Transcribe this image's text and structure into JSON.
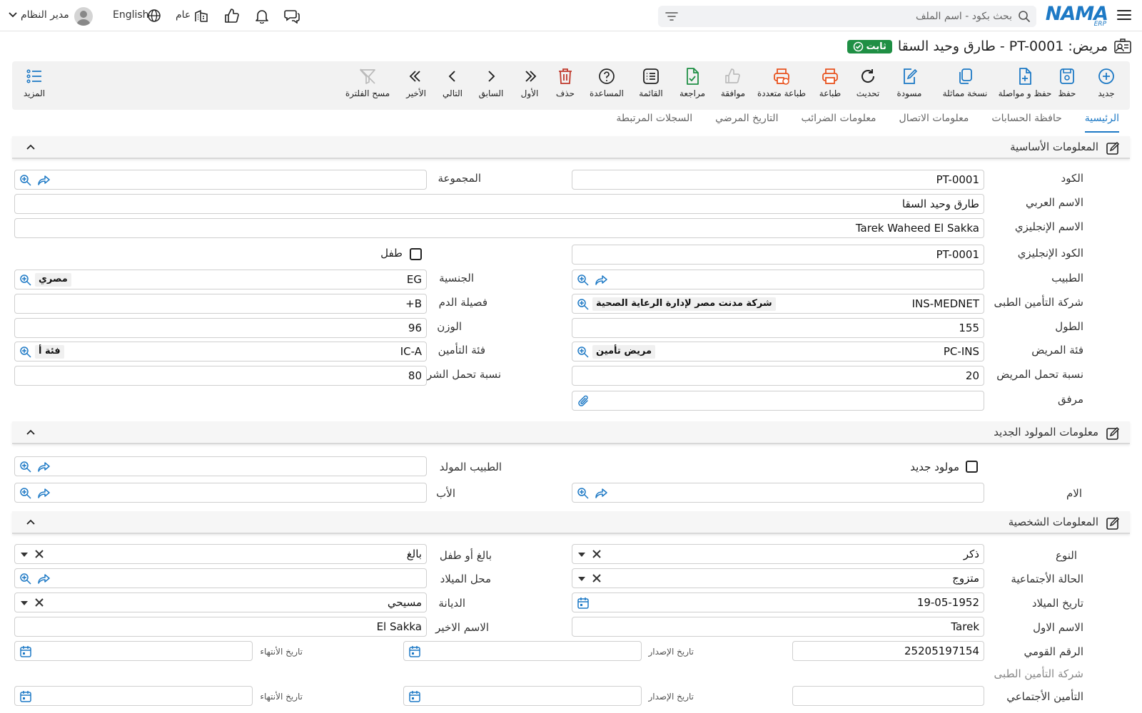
{
  "header": {
    "logo_main": "NAMA",
    "logo_sub": "ERP",
    "search_placeholder": "بحث بكود - اسم الملف",
    "branch_label": "عام",
    "language_label": "English",
    "user_label": "مدير النظام"
  },
  "title": {
    "text": "مريض: PT-0001 - طارق وحيد السقا",
    "badge": "ثابت"
  },
  "toolbar": {
    "buttons": [
      {
        "label": "جديد",
        "icon": "plus-circle-icon"
      },
      {
        "label": "حفظ",
        "icon": "save-icon"
      },
      {
        "label": "حفظ و مواصلة",
        "icon": "file-plus-icon"
      },
      {
        "label": "نسخة مماثلة",
        "icon": "copy-icon"
      },
      {
        "label": "مسودة",
        "icon": "draft-icon"
      },
      {
        "label": "تحديث",
        "icon": "refresh-icon"
      },
      {
        "label": "طباعة",
        "icon": "printer-icon"
      },
      {
        "label": "طباعة متعددة",
        "icon": "multi-print-icon"
      },
      {
        "label": "موافقة",
        "icon": "thumbs-up-icon"
      },
      {
        "label": "مراجعة",
        "icon": "review-icon"
      },
      {
        "label": "القائمة",
        "icon": "list-icon"
      },
      {
        "label": "المساعدة",
        "icon": "help-icon"
      },
      {
        "label": "حذف",
        "icon": "trash-icon"
      },
      {
        "label": "الأول",
        "icon": "first-icon"
      },
      {
        "label": "السابق",
        "icon": "previous-icon"
      },
      {
        "label": "التالي",
        "icon": "next-icon"
      },
      {
        "label": "الأخير",
        "icon": "last-icon"
      },
      {
        "label": "مسح الفلترة",
        "icon": "clear-filter-icon"
      }
    ],
    "more_label": "المزيد"
  },
  "tabs": [
    "الرئيسية",
    "حافظة الحسابات",
    "معلومات الاتصال",
    "معلومات الضرائب",
    "التاريخ المرضي",
    "السجلات المرتبطة"
  ],
  "sections": {
    "basic": "المعلومات الأساسية",
    "newborn": "معلومات المولود الجديد",
    "personal": "المعلومات الشخصية"
  },
  "basic": {
    "code_label": "الكود",
    "code": "PT-0001",
    "group_label": "المجموعة",
    "arabic_name_label": "الاسم العربي",
    "arabic_name": "طارق وحيد السقا",
    "english_name_label": "الاسم الإنجليزي",
    "english_name": "Tarek Waheed El Sakka",
    "english_code_label": "الكود الإنجليزي",
    "english_code": "PT-0001",
    "child_label": "طفل",
    "doctor_label": "الطبيب",
    "nationality_label": "الجنسية",
    "nationality_code": "EG",
    "nationality_name": "مصري",
    "insurance_company_label": "شركة التأمين الطبى",
    "insurance_company_code": "INS-MEDNET",
    "insurance_company_name": "شركة مدنت مصر لإدارة الرعاية الصحية",
    "blood_type_label": "فصيلة الدم",
    "blood_type": "B+",
    "height_label": "الطول",
    "height": "155",
    "weight_label": "الوزن",
    "weight": "96",
    "patient_category_label": "فئة المريض",
    "patient_category_code": "PC-INS",
    "patient_category_name": "مريض تأمين",
    "insurance_category_label": "فئة التأمين",
    "insurance_category_code": "IC-A",
    "insurance_category_name": "فئة أ",
    "patient_share_label": "نسبة تحمل المريض",
    "patient_share": "20",
    "company_share_label": "نسبة تحمل الشركة",
    "company_share": "80",
    "attachment_label": "مرفق"
  },
  "newborn": {
    "newborn_label": "مولود جديد",
    "delivery_doctor_label": "الطبيب المولد",
    "mother_label": "الام",
    "father_label": "الأب"
  },
  "personal": {
    "gender_label": "النوع",
    "gender": "ذكر",
    "adult_child_label": "بالغ أو طفل",
    "adult_child": "بالغ",
    "marital_label": "الحالة الأجتماعية",
    "marital": "متزوج",
    "birthplace_label": "محل الميلاد",
    "birthdate_label": "تاريخ الميلاد",
    "birthdate": "19-05-1952",
    "religion_label": "الديانة",
    "religion": "مسيحي",
    "first_name_label": "الاسم الاول",
    "first_name": "Tarek",
    "last_name_label": "الاسم الاخير",
    "last_name": "El Sakka",
    "national_id_label": "الرقم القومي",
    "national_id": "25205197154",
    "issue_date_label": "تاريخ الإصدار",
    "expiry_date_label": "تاريخ الأنتهاء",
    "insurance_company_label": "شركة التأمين الطبى",
    "social_insurance_label": "التأمين الأجتماعي"
  },
  "colors": {
    "accent": "#1d79c5",
    "badge": "#1f8f44",
    "delete": "#c0392b",
    "print": "#e8531f"
  }
}
